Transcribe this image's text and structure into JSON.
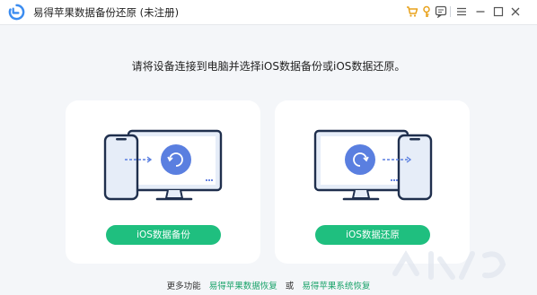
{
  "app": {
    "title": "易得苹果数据备份还原 (未注册)",
    "accent_color": "#1fbf7f",
    "logo_color": "#3b8cf0"
  },
  "titlebar": {
    "icons": [
      "cart-icon",
      "key-icon",
      "feedback-icon",
      "menu-icon",
      "minimize-icon",
      "maximize-icon",
      "close-icon"
    ]
  },
  "main": {
    "instruction": "请将设备连接到电脑并选择iOS数据备份或iOS数据还原。",
    "cards": [
      {
        "button_label": "iOS数据备份",
        "illustration": "phone-to-computer-backup"
      },
      {
        "button_label": "iOS数据还原",
        "illustration": "computer-to-phone-restore"
      }
    ]
  },
  "footer": {
    "more_label": "更多功能",
    "link1": "易得苹果数据恢复",
    "or_label": "或",
    "link2": "易得苹果系统恢复"
  }
}
